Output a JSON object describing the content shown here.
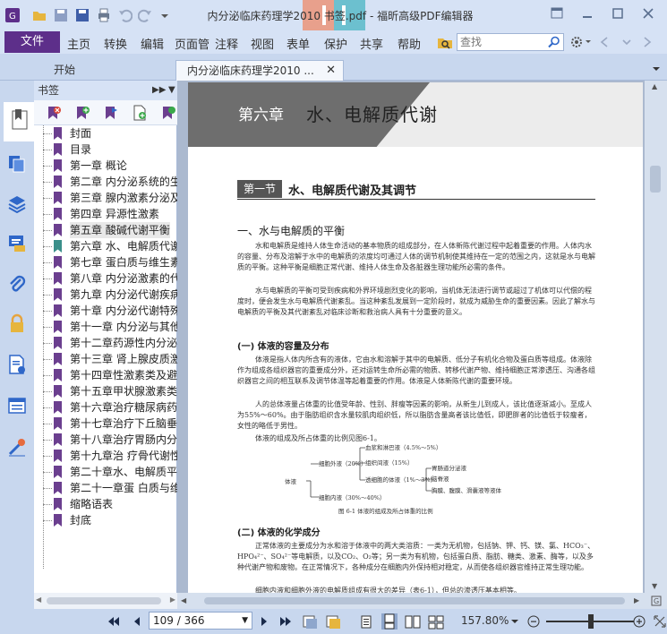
{
  "window": {
    "title": "内分泌临床药理学2010 书签.pdf - 福昕高级PDF编辑器"
  },
  "menu": {
    "file": "文件",
    "items": [
      "主页",
      "转换",
      "编辑",
      "页面管",
      "注释",
      "视图",
      "表单",
      "保护",
      "共享",
      "帮助"
    ],
    "search_placeholder": "查找"
  },
  "tabs": [
    {
      "label": "开始"
    },
    {
      "label": "内分泌临床药理学2010 ..."
    }
  ],
  "bookmarks": {
    "header": "书签",
    "items": [
      {
        "label": "封面"
      },
      {
        "label": "目录"
      },
      {
        "label": "第一章 概论"
      },
      {
        "label": "第二章 内分泌系统的生"
      },
      {
        "label": "第三章 腺内激素分泌及"
      },
      {
        "label": "第四章 异源性激素"
      },
      {
        "label": "第五章 酸碱代谢平衡"
      },
      {
        "label": "第六章 水、电解质代谢"
      },
      {
        "label": "第七章 蛋白质与维生素"
      },
      {
        "label": "第八章 内分泌激素的代"
      },
      {
        "label": "第九章 内分泌代谢疾病"
      },
      {
        "label": "第十章 内分泌代谢特殊"
      },
      {
        "label": "第十一章 内分泌与其他"
      },
      {
        "label": "第十二章药源性内分泌"
      },
      {
        "label": "第十三章 肾上腺皮质激"
      },
      {
        "label": "第十四章性激素类及避"
      },
      {
        "label": "第十五章甲状腺激素类"
      },
      {
        "label": "第十六章治疗糖尿病药"
      },
      {
        "label": "第十七章治疗下丘脑垂"
      },
      {
        "label": "第十八章治疗胃肠内分"
      },
      {
        "label": "第十九章治 疗骨代谢性"
      },
      {
        "label": "第二十章水、电解质平"
      },
      {
        "label": "第二十一章蛋 白质与维"
      },
      {
        "label": "缩略语表"
      },
      {
        "label": "封底"
      }
    ]
  },
  "document": {
    "chapter_num": "第六章",
    "chapter_title": "水、电解质代谢",
    "section_tag": "第一节",
    "section_title": "水、电解质代谢及其调节",
    "h2_1": "一、水与电解质的平衡",
    "p1": "水和电解质是维持人体生命活动的基本物质的组成部分，在人体新陈代谢过程中起着重要的作用。人体内水的容量、分布及溶解于水中的电解质的浓度均可通过人体的调节机制使其维持在一定的范围之内，这就是水与电解质的平衡。这种平衡是细胞正常代谢、维持人体生命及各脏器生理功能所必需的条件。",
    "p2": "水与电解质的平衡可受到疾病和外界环境剧烈变化的影响，当机体无法进行调节或超过了机体可以代偿的程度时，便会发生水与电解质代谢紊乱。当这种紊乱发展到一定阶段时，就成为威胁生命的重要因素。因此了解水与电解质的平衡及其代谢紊乱对临床诊断和救治病人具有十分重要的意义。",
    "h3_1": "(一) 体液的容量及分布",
    "p3": "体液是指人体内所含有的液体，它由水和溶解于其中的电解质、低分子有机化合物及蛋白质等组成。体液除作为组成各组织器官的重要成分外，还对运转生命所必需的物质、转移代谢产物、维持细胞正常渗透压、沟通各组织器官之间的相互联系及调节体温等起着重要的作用。体液是人体新陈代谢的重要环境。",
    "p4": "人的总体液量占体重的比值受年龄、性别、胖瘦等因素的影响，从新生儿到成人，该比值逐渐减小。至成人为55%～60%。由于脂肪组织含水量较肌肉组织低，所以脂肪含量高者该比值低，即肥胖者的比值低于较瘦者，女性的略低于男性。",
    "p5": "体液的组成及所占体重的比例见图6-1。",
    "fig": {
      "body_fluid": "体液",
      "intracellular": "细胞内液（30%～40%）",
      "extracellular": "细胞外液（20%）",
      "plasma": "血浆和淋巴液（4.5%～5%）",
      "interstitial": "组织间液（15%）",
      "transcellular": "透细胞的体液（1%～3%）",
      "t1": "胃肠道分泌液",
      "t2": "脑脊液",
      "t3": "胸膜、腹膜、滑囊液等液体",
      "caption": "图 6-1   体液的组成及所占体重的比例"
    },
    "h3_2": "(二) 体液的化学成分",
    "p6": "正常体液的主要成分为水和溶于体液中的两大类溶质：一类为无机物，包括钠、钾、钙、镁、氯、HCO₃⁻、HPO₄²⁻、SO₄²⁻等电解质，以及CO₂、O₂等；另一类为有机物，包括蛋白质、脂肪、糖类、激素、酶等，以及多种代谢产物和废物。在正常情况下，各种成分在细胞内外保持相对稳定，从而使各组织器官维持正常生理功能。",
    "p7": "细胞内液和细胞外液的电解质组成有很大的差异（表6-1），但总的渗透压基本相等。"
  },
  "status": {
    "page": "109 / 366",
    "zoom": "157.80%"
  },
  "colors": {
    "file_button": "#5d2f8a",
    "bookmark_flag": "#6b3f8f",
    "accent_blue": "#2f67c8"
  }
}
